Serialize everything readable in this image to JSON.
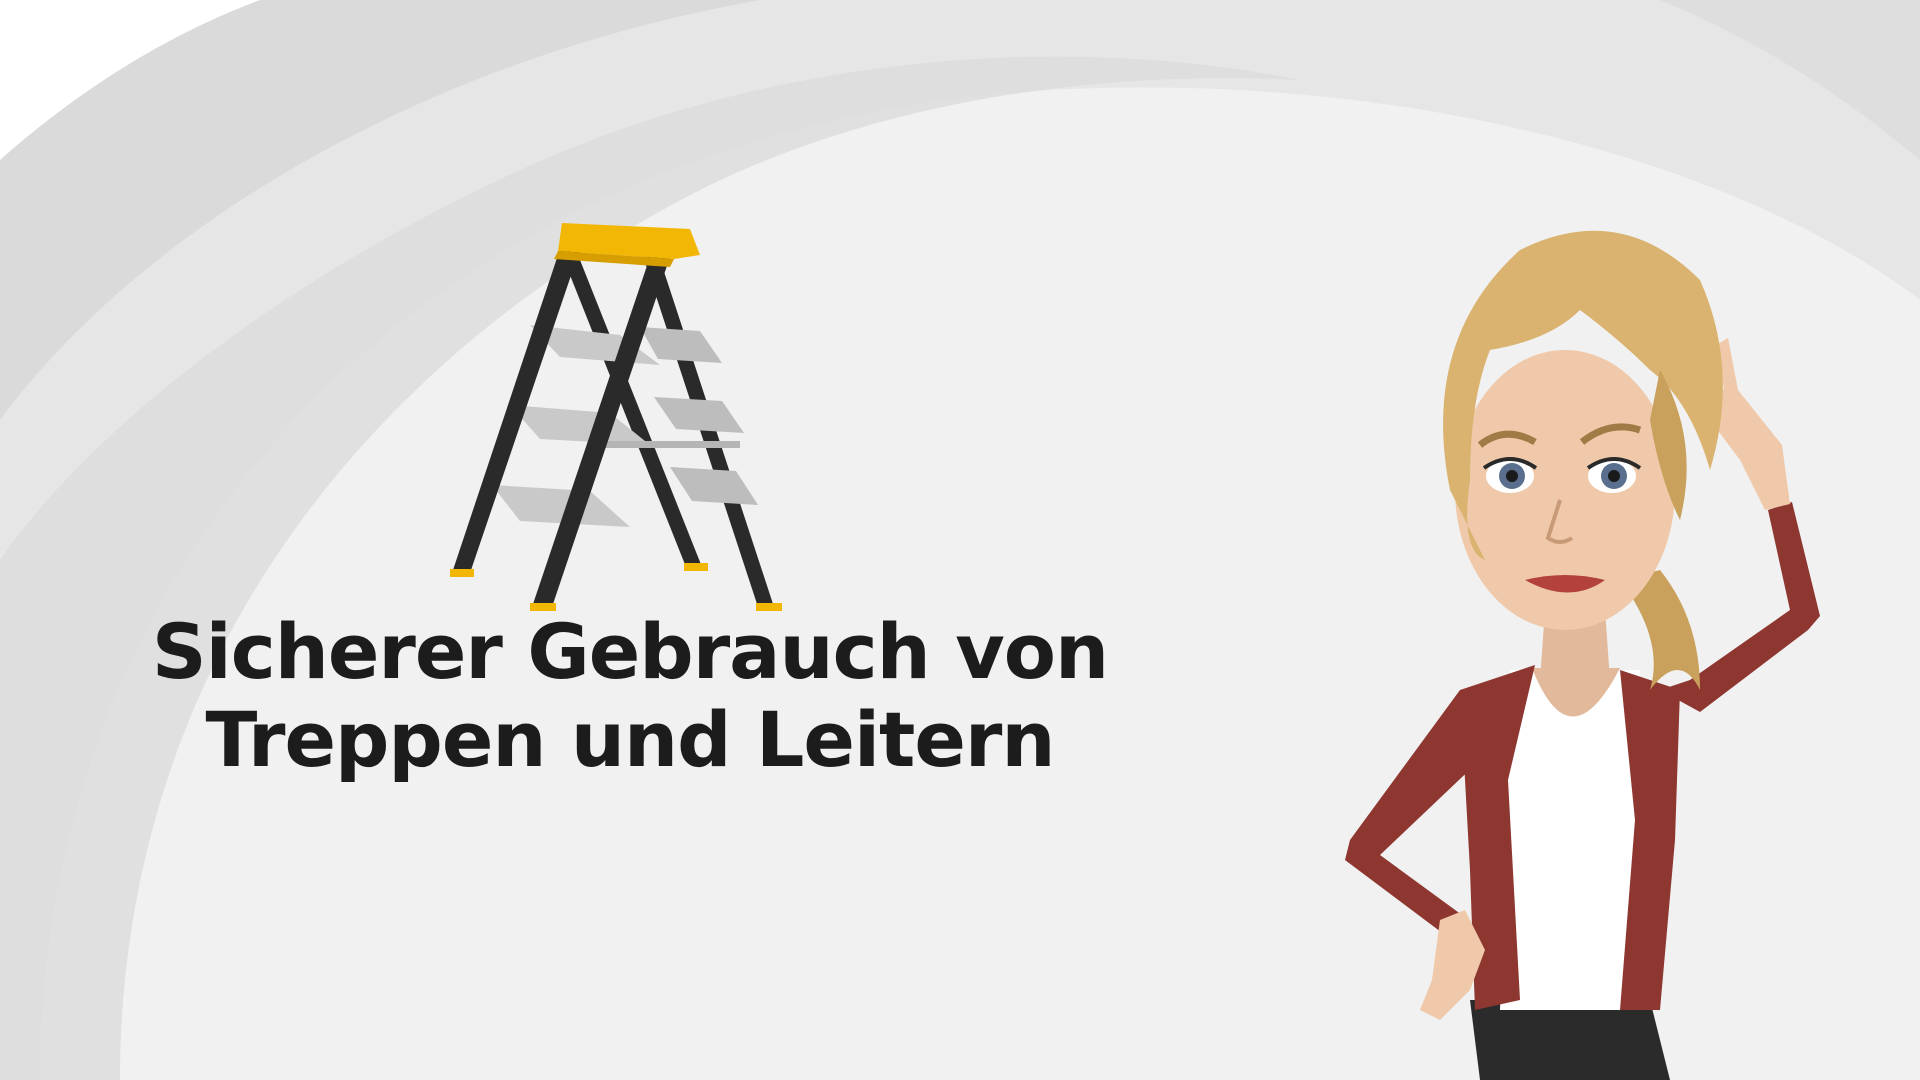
{
  "title": {
    "line1": "Sicherer Gebrauch von",
    "line2": "Treppen und Leitern"
  },
  "illustration": {
    "ladder_icon": "stepladder-icon",
    "character": "presenter-woman"
  },
  "colors": {
    "background": "#f1f1f1",
    "arc_light": "#e6e6e6",
    "arc_mid": "#dcdcdc",
    "ladder_frame": "#2a2a2a",
    "ladder_cap": "#f2b705",
    "ladder_steps": "#c9c9c9",
    "jacket": "#8e3630",
    "hair": "#d9b36f",
    "skin": "#efc9a9",
    "title_text": "#1c1c1c"
  }
}
